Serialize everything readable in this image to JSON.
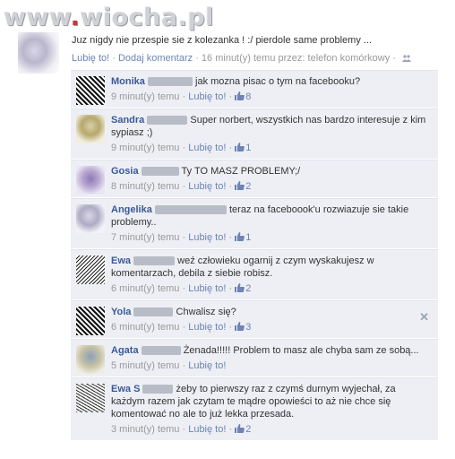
{
  "watermark": {
    "prefix": "www",
    "dot": ".",
    "site": "wiocha.pl"
  },
  "post": {
    "text": "Juz nigdy nie przespie sie z kolezanka ! :/ pierdole same problemy ...",
    "like_label": "Lubię to!",
    "sep": " · ",
    "comment_label": "Dodaj komentarz",
    "meta": "16 minut(y) temu przez: telefon komórkowy",
    "meta_sep": " · "
  },
  "comments": [
    {
      "name": "Monika",
      "text": "jak mozna pisac o tym na facebooku?",
      "time": "9 minut(y) temu",
      "like_label": "Lubię to!",
      "likes": "8"
    },
    {
      "name": "Sandra",
      "text": "Super norbert, wszystkich nas bardzo interesuje z kim sypiasz ;)",
      "time": "9 minut(y) temu",
      "like_label": "Lubię to!",
      "likes": "1"
    },
    {
      "name": "Gosia",
      "text": "Ty TO MASZ PROBLEMY;/",
      "time": "8 minut(y) temu",
      "like_label": "Lubię to!",
      "likes": "2"
    },
    {
      "name": "Angelika",
      "text": "teraz na faceboook'u rozwiazuje sie takie problemy..",
      "time": "7 minut(y) temu",
      "like_label": "Lubię to!",
      "likes": "1"
    },
    {
      "name": "Ewa",
      "text": "weź człowieku ogarnij z czym wyskakujesz w komentarzach, debila z siebie robisz.",
      "time": "6 minut(y) temu",
      "like_label": "Lubię to!",
      "likes": "2"
    },
    {
      "name": "Yola",
      "text": "Chwalisz się?",
      "time": "6 minut(y) temu",
      "like_label": "Lubię to!",
      "likes": "3"
    },
    {
      "name": "Agata",
      "text": "Żenada!!!!! Problem to masz ale chyba sam ze sobą...",
      "time": "5 minut(y) temu",
      "like_label": "Lubię to!",
      "likes": ""
    },
    {
      "name": "Ewa S",
      "text": "żeby to pierwszy raz z czymś durnym wyjechał, za każdym razem jak czytam te mądre opowieści to aż nie chce się komentować no ale to już lekka przesada.",
      "time": "3 minut(y) temu",
      "like_label": "Lubię to!",
      "likes": "2"
    }
  ],
  "close_glyph": "✕",
  "colors": {
    "link": "#6d84b4",
    "name": "#3b5998",
    "comment_bg": "#edeff4"
  },
  "icons": {
    "like": "thumbs-up-icon",
    "audience": "people-icon",
    "close": "close-icon"
  }
}
